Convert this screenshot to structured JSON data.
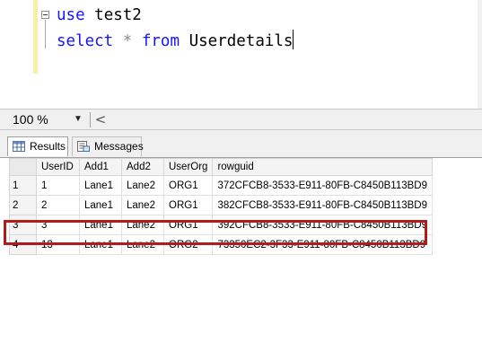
{
  "editor": {
    "line1": {
      "keyword": "use",
      "identifier": "test2"
    },
    "line2": {
      "keyword_select": "select",
      "star": "*",
      "keyword_from": "from",
      "table": "Userdetails"
    }
  },
  "zoom": {
    "value": "100 %",
    "arrow": "▼",
    "scroll_left": "<"
  },
  "tabs": [
    {
      "label": "Results",
      "icon": "grid-icon",
      "active": true
    },
    {
      "label": "Messages",
      "icon": "messages-icon",
      "active": false
    }
  ],
  "grid": {
    "columns": [
      "UserID",
      "Add1",
      "Add2",
      "UserOrg",
      "rowguid"
    ],
    "rows": [
      {
        "n": "1",
        "cells": [
          "1",
          "Lane1",
          "Lane2",
          "ORG1",
          "372CFCB8-3533-E911-80FB-C8450B113BD9"
        ]
      },
      {
        "n": "2",
        "cells": [
          "2",
          "Lane1",
          "Lane2",
          "ORG1",
          "382CFCB8-3533-E911-80FB-C8450B113BD9"
        ]
      },
      {
        "n": "3",
        "cells": [
          "3",
          "Lane1",
          "Lane2",
          "ORG1",
          "392CFCB8-3533-E911-80FB-C8450B113BD9"
        ]
      },
      {
        "n": "4",
        "cells": [
          "13",
          "Lane1",
          "Lane2",
          "ORG2",
          "73350EC2-3F33-E911-80FB-C8450B113BD9"
        ]
      }
    ]
  },
  "colors": {
    "keyword": "#1515ff",
    "highlight": "#b21b1b"
  }
}
